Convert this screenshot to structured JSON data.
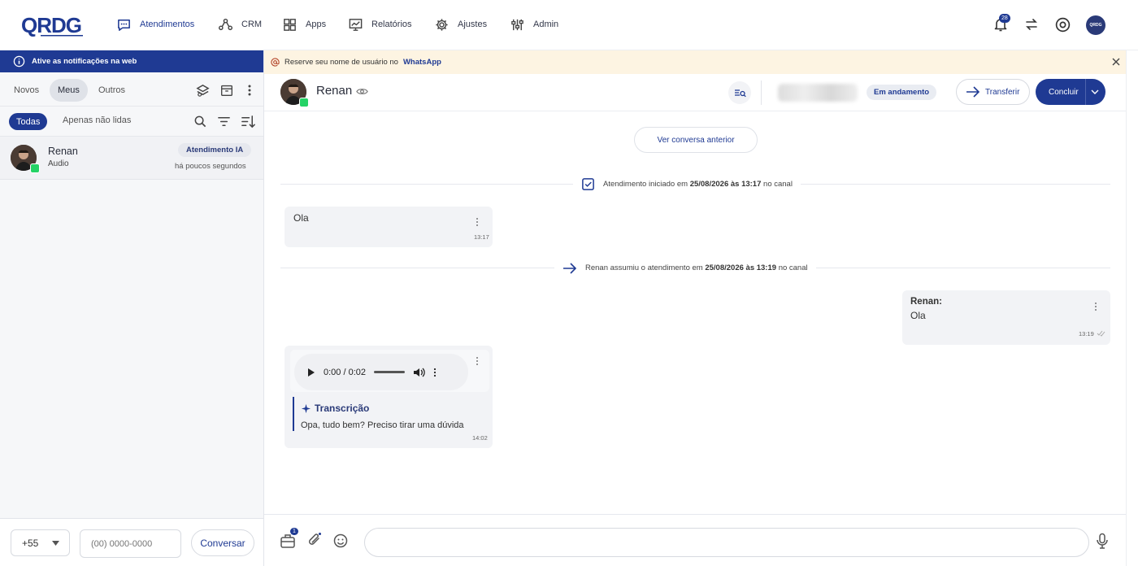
{
  "nav": {
    "items": [
      {
        "label": "Atendimentos",
        "icon": "chat-bubble-icon",
        "active": true
      },
      {
        "label": "CRM",
        "icon": "crm-icon"
      },
      {
        "label": "Apps",
        "icon": "apps-grid-icon"
      },
      {
        "label": "Relatórios",
        "icon": "reports-icon"
      },
      {
        "label": "Ajustes",
        "icon": "gear-icon"
      },
      {
        "label": "Admin",
        "icon": "admin-sliders-icon"
      }
    ],
    "notification_count": "28",
    "avatar_text": "QRDG"
  },
  "left_panel": {
    "notify_banner": "Ative as notificações na web",
    "tabs": [
      "Novos",
      "Meus",
      "Outros"
    ],
    "selected_tab": "Meus",
    "filter_all": "Todas",
    "filter_unread": "Apenas não lidas",
    "conversations": [
      {
        "name": "Renan",
        "preview": "Audio",
        "tag": "Atendimento IA",
        "time": "há poucos segundos"
      }
    ],
    "ddi": "+55",
    "phone_placeholder": "(00) 0000-0000",
    "talk_button": "Conversar"
  },
  "chat": {
    "banner_prefix": "Reserve seu nome de usuário no",
    "banner_brand": "WhatsApp",
    "contact_name": "Renan",
    "status": "Em andamento",
    "transfer_label": "Transferir",
    "conclude_label": "Concluir",
    "previous_button": "Ver conversa anterior",
    "sys1": {
      "pre": "Atendimento iniciado em",
      "date": "25/08/2026 às 13:17",
      "post": "no canal"
    },
    "sys2": {
      "pre": "Renan assumiu o atendimento em",
      "date": "25/08/2026 às 13:19",
      "post": "no canal"
    },
    "msg_in_1": {
      "text": "Ola",
      "time": "13:17"
    },
    "msg_out_1": {
      "sender": "Renan:",
      "text": "Ola",
      "time": "13:19"
    },
    "msg_audio": {
      "player_time": "0:00 / 0:02",
      "transcription_title": "Transcrição",
      "transcription_text": "Opa, tudo bem? Preciso tirar uma dúvida",
      "time": "14:02"
    },
    "templates_badge": "1"
  },
  "colors": {
    "brand": "#1f3a93",
    "whatsapp": "#25d366",
    "banner_bg": "#fdf4e2"
  }
}
